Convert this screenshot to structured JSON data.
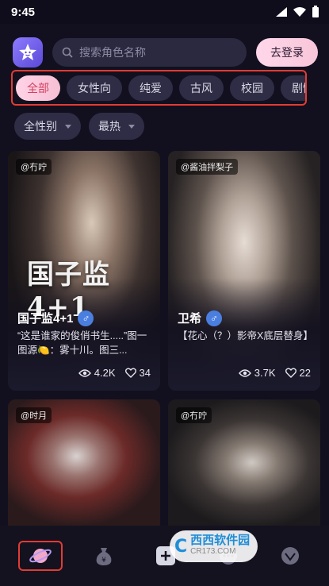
{
  "status_bar": {
    "time": "9:45"
  },
  "header": {
    "search_placeholder": "搜索角色名称",
    "login_label": "去登录"
  },
  "tags": [
    "全部",
    "女性向",
    "纯爱",
    "古风",
    "校园",
    "剧情"
  ],
  "filters": {
    "gender": "全性别",
    "sort": "最热"
  },
  "cards": [
    {
      "author": "@冇咛",
      "overlay": "国子监4+1",
      "title": "国子监4+1",
      "gender": "♂",
      "desc": "“这是谁家的俊俏书生.....”图一图源🍋：雾十川。图三...",
      "views": "4.2K",
      "likes": "34"
    },
    {
      "author": "@酱油拌梨子",
      "title": "卫希",
      "gender": "♂",
      "desc": "【花心（？）影帝X底层替身】",
      "views": "3.7K",
      "likes": "22"
    },
    {
      "author": "@时月"
    },
    {
      "author": "@冇咛"
    }
  ],
  "watermark": {
    "logo": "C",
    "main": "西西软件园",
    "sub": "CR173.COM"
  },
  "colors": {
    "accent_pink": "#f8c6d8",
    "highlight_red": "#e33b34",
    "background": "#12101f"
  }
}
